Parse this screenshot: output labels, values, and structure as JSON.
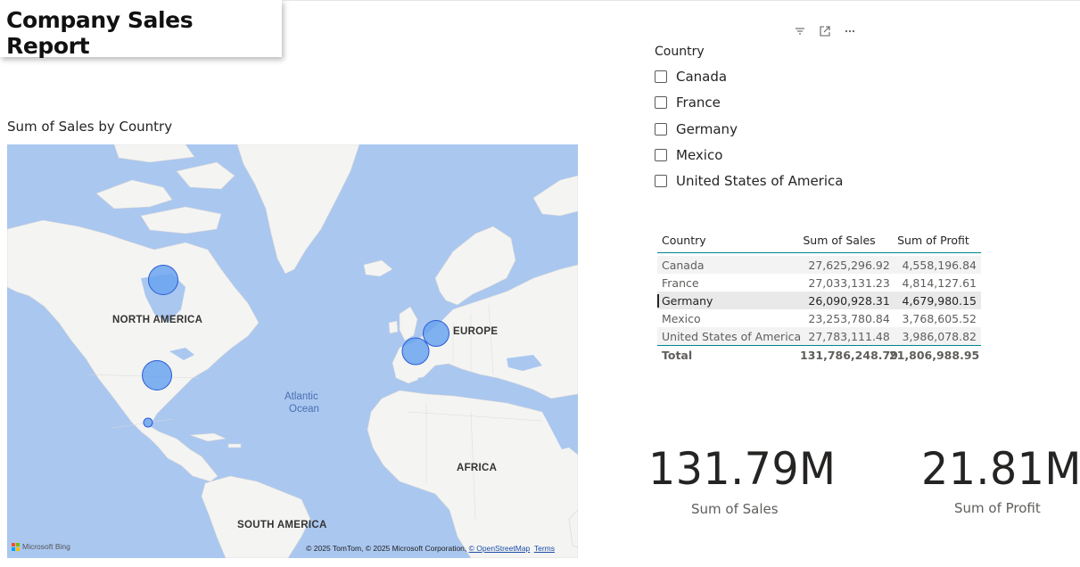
{
  "report": {
    "title": "Company Sales Report"
  },
  "map": {
    "title": "Sum of Sales by Country",
    "labels": {
      "north_america": "NORTH AMERICA",
      "south_america": "SOUTH AMERICA",
      "europe": "EUROPE",
      "africa": "AFRICA",
      "ocean_line1": "Atlantic",
      "ocean_line2": "Ocean"
    },
    "attribution": "© 2025 TomTom, © 2025 Microsoft Corporation,",
    "attribution_link": "© OpenStreetMap",
    "terms_link": "Terms",
    "provider": "Microsoft Bing",
    "bubble_color": "#6aa3ee",
    "bubble_stroke": "#2a5bd7"
  },
  "visual_header": {
    "icons": [
      "filter-icon",
      "focus-mode-icon",
      "more-options-icon"
    ]
  },
  "slicer": {
    "title": "Country",
    "items": [
      {
        "label": "Canada",
        "checked": false
      },
      {
        "label": "France",
        "checked": false
      },
      {
        "label": "Germany",
        "checked": false
      },
      {
        "label": "Mexico",
        "checked": false
      },
      {
        "label": "United States of America",
        "checked": false
      }
    ]
  },
  "table": {
    "columns": [
      "Country",
      "Sum of Sales",
      "Sum of Profit"
    ],
    "rows": [
      {
        "country": "Canada",
        "sales": "27,625,296.92",
        "profit": "4,558,196.84"
      },
      {
        "country": "France",
        "sales": "27,033,131.23",
        "profit": "4,814,127.61"
      },
      {
        "country": "Germany",
        "sales": "26,090,928.31",
        "profit": "4,679,980.15"
      },
      {
        "country": "Mexico",
        "sales": "23,253,780.84",
        "profit": "3,768,605.52"
      },
      {
        "country": "United States of America",
        "sales": "27,783,111.48",
        "profit": "3,986,078.82"
      }
    ],
    "total": {
      "label": "Total",
      "sales": "131,786,248.79",
      "profit": "21,806,988.95"
    },
    "accent": "#00848f"
  },
  "cards": {
    "sales": {
      "value": "131.79M",
      "label": "Sum of  Sales"
    },
    "profit": {
      "value": "21.81M",
      "label": "Sum of Profit"
    }
  }
}
